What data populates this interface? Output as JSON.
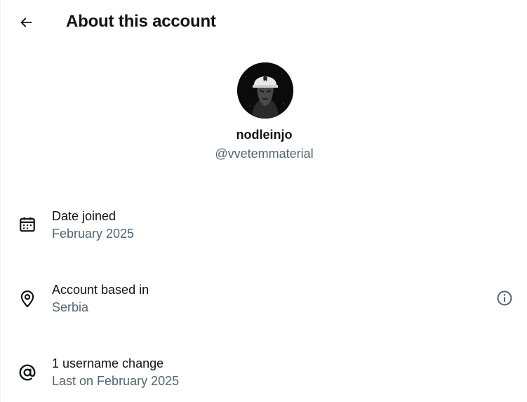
{
  "header": {
    "title": "About this account",
    "back_icon": "arrow-left-icon"
  },
  "profile": {
    "display_name": "nodleinjo",
    "handle": "@vvetemmaterial",
    "avatar_icon": "profile-avatar"
  },
  "details": [
    {
      "icon": "calendar-icon",
      "label": "Date joined",
      "value": "February 2025"
    },
    {
      "icon": "location-pin-icon",
      "label": "Account based in",
      "value": "Serbia",
      "info_icon": "info-icon"
    },
    {
      "icon": "at-sign-icon",
      "label": "1 username change",
      "value": "Last on February 2025"
    }
  ],
  "colors": {
    "primary_text": "#0f1419",
    "secondary_text": "#536471",
    "background": "#ffffff"
  }
}
